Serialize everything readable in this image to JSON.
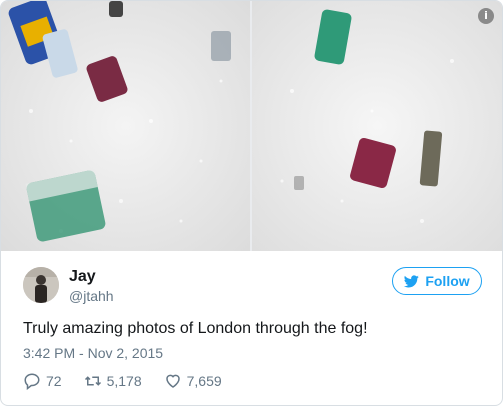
{
  "tweet": {
    "author_name": "Jay",
    "author_handle": "@jtahh",
    "follow_label": "Follow",
    "text": "Truly amazing photos of London through the fog!",
    "timestamp": "3:42 PM - Nov 2, 2015",
    "replies": "72",
    "retweets": "5,178",
    "likes": "7,659"
  },
  "media": {
    "info_icon_glyph": "i",
    "photos": [
      {
        "description_icon": "bathtub-bubbles-photo"
      },
      {
        "description_icon": "bathtub-bubbles-photo"
      }
    ]
  },
  "colors": {
    "accent": "#1da1f2",
    "secondary_text": "#657786",
    "primary_text": "#14171a"
  }
}
